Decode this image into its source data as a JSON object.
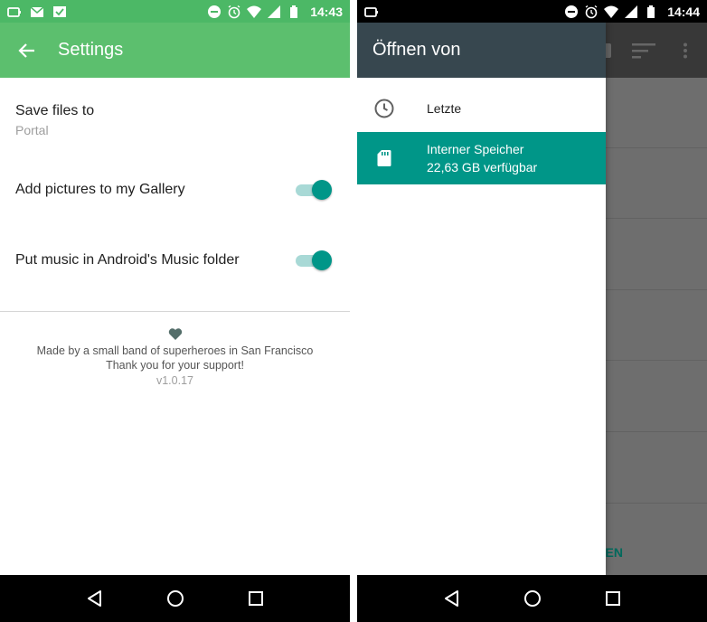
{
  "left": {
    "status": {
      "time": "14:43"
    },
    "app_bar": {
      "title": "Settings"
    },
    "settings": [
      {
        "title": "Save files to",
        "subtitle": "Portal"
      },
      {
        "title": "Add pictures to my Gallery",
        "toggle_on": true
      },
      {
        "title": "Put music in Android's Music folder",
        "toggle_on": true
      }
    ],
    "footer": {
      "line1": "Made by a small band of superheroes in San Francisco",
      "line2": "Thank you for your support!",
      "version": "v1.0.17"
    }
  },
  "right": {
    "status": {
      "time": "14:44"
    },
    "drawer": {
      "title": "Öffnen von",
      "items": [
        {
          "label": "Letzte",
          "icon": "clock-icon"
        },
        {
          "label": "Interner Speicher",
          "sublabel": "22,63 GB verfügbar",
          "icon": "sd-card-icon",
          "selected": true
        }
      ]
    },
    "background_app": {
      "button_label_fragment": "LEN"
    }
  },
  "colors": {
    "settings_appbar": "#5cbf6e",
    "settings_statusbar": "#4cb866",
    "accent_teal": "#009688",
    "drawer_header": "#37474f"
  }
}
